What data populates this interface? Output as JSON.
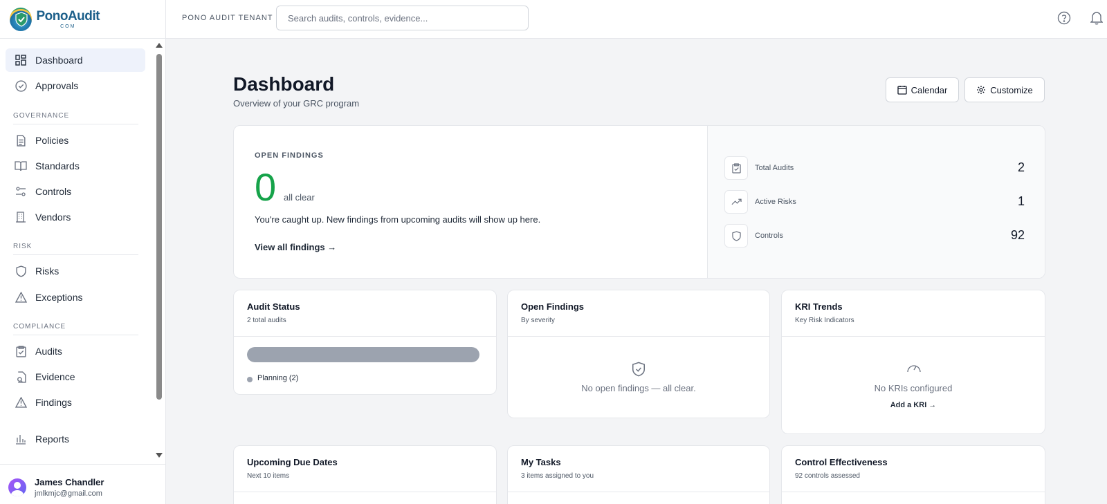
{
  "brand": {
    "name": "PonoAudit",
    "suffix": "COM"
  },
  "topbar": {
    "tenant": "PONO AUDIT TENANT",
    "search_placeholder": "Search audits, controls, evidence..."
  },
  "sidebar": {
    "items_top": [
      {
        "label": "Dashboard",
        "icon": "grid-icon",
        "active": true
      },
      {
        "label": "Approvals",
        "icon": "check-circle-icon"
      }
    ],
    "sections": [
      {
        "label": "GOVERNANCE",
        "items": [
          {
            "label": "Policies",
            "icon": "document-icon"
          },
          {
            "label": "Standards",
            "icon": "book-icon"
          },
          {
            "label": "Controls",
            "icon": "sliders-icon"
          },
          {
            "label": "Vendors",
            "icon": "building-icon"
          }
        ]
      },
      {
        "label": "RISK",
        "items": [
          {
            "label": "Risks",
            "icon": "shield-icon"
          },
          {
            "label": "Exceptions",
            "icon": "warning-icon"
          }
        ]
      },
      {
        "label": "COMPLIANCE",
        "items": [
          {
            "label": "Audits",
            "icon": "clipboard-check-icon"
          },
          {
            "label": "Evidence",
            "icon": "file-search-icon"
          },
          {
            "label": "Findings",
            "icon": "warning-icon"
          }
        ]
      }
    ],
    "reports": {
      "label": "Reports",
      "icon": "bar-chart-icon"
    }
  },
  "user": {
    "name": "James Chandler",
    "email": "jmlkmjc@gmail.com"
  },
  "header": {
    "title": "Dashboard",
    "subtitle": "Overview of your GRC program",
    "calendar_label": "Calendar",
    "customize_label": "Customize"
  },
  "open_findings": {
    "label": "OPEN FINDINGS",
    "count": "0",
    "status": "all clear",
    "message": "You're caught up. New findings from upcoming audits will show up here.",
    "link": "View all findings →"
  },
  "stats": [
    {
      "label": "Total Audits",
      "value": "2",
      "icon": "clipboard-check-icon"
    },
    {
      "label": "Active Risks",
      "value": "1",
      "icon": "trending-up-icon"
    },
    {
      "label": "Controls",
      "value": "92",
      "icon": "shield-icon"
    }
  ],
  "widgets": {
    "audit_status": {
      "title": "Audit Status",
      "subtitle": "2 total audits",
      "planning_fraction": 1.0,
      "legend": "Planning (2)"
    },
    "open_findings": {
      "title": "Open Findings",
      "subtitle": "By severity",
      "empty": "No open findings — all clear."
    },
    "kri_trends": {
      "title": "KRI Trends",
      "subtitle": "Key Risk Indicators",
      "empty": "No KRIs configured",
      "link": "Add a KRI →"
    },
    "due_dates": {
      "title": "Upcoming Due Dates",
      "subtitle": "Next 10 items"
    },
    "my_tasks": {
      "title": "My Tasks",
      "subtitle": "3 items assigned to you"
    },
    "control_effectiveness": {
      "title": "Control Effectiveness",
      "subtitle": "92 controls assessed"
    }
  },
  "colors": {
    "accent": "#16a34a",
    "brand": "#1c5f8a",
    "bar": "#9ca3af"
  }
}
